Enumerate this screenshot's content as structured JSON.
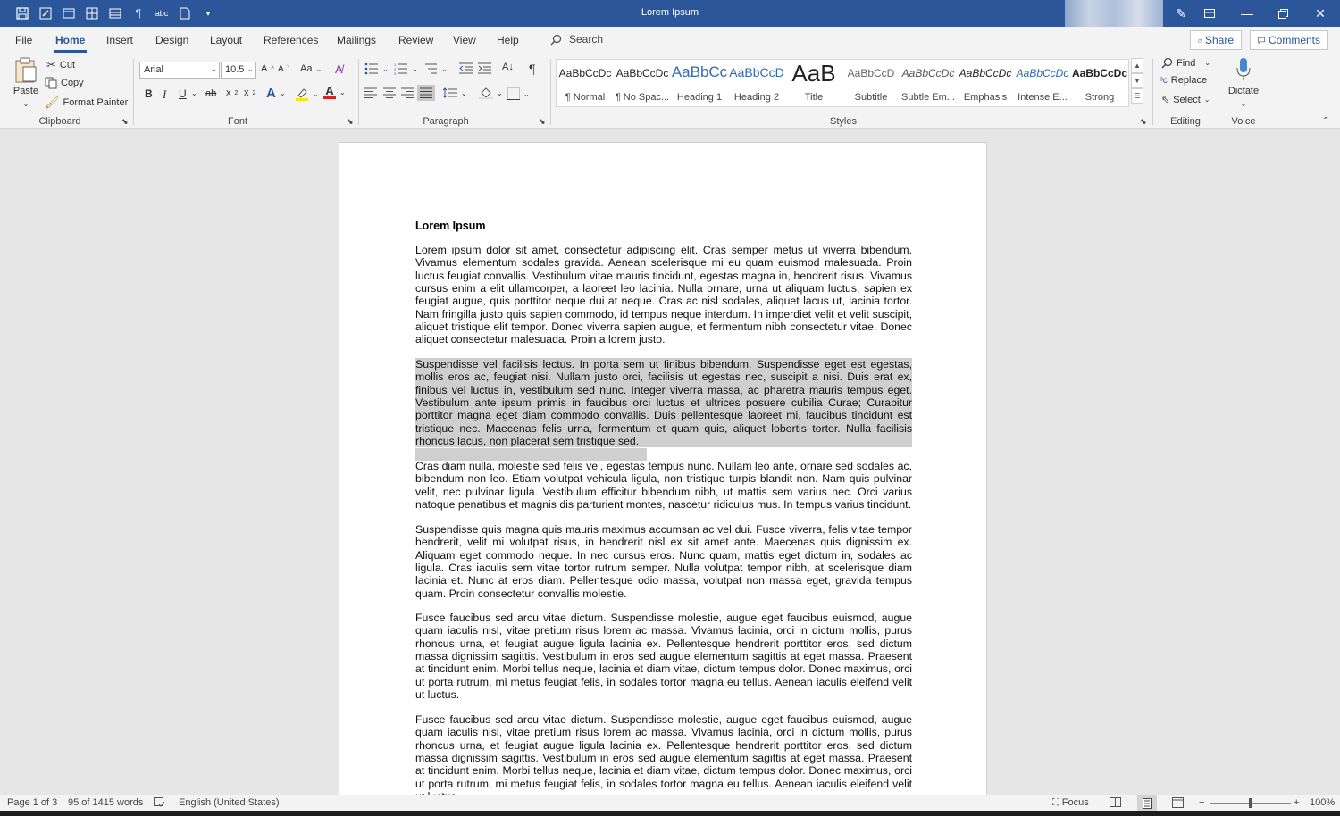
{
  "window": {
    "title": "Lorem Ipsum",
    "controls": [
      "minimize",
      "restore",
      "close"
    ]
  },
  "qat_icons": [
    "save-icon",
    "edit-icon",
    "window-icon",
    "table-icon",
    "layout-icon",
    "pilcrow-icon",
    "spelling-icon",
    "new-doc-icon",
    "customize-icon"
  ],
  "tabs": [
    "File",
    "Home",
    "Insert",
    "Design",
    "Layout",
    "References",
    "Mailings",
    "Review",
    "View",
    "Help"
  ],
  "active_tab": "Home",
  "search": {
    "label": "Search"
  },
  "top_right": {
    "share": "Share",
    "comments": "Comments"
  },
  "clipboard": {
    "paste": "Paste",
    "cut": "Cut",
    "copy": "Copy",
    "format_painter": "Format Painter",
    "label": "Clipboard"
  },
  "font": {
    "name": "Arial",
    "size": "10.5",
    "change_case": "Aa",
    "bold": "B",
    "italic": "I",
    "underline": "U",
    "strike": "ab",
    "subscript": "x",
    "superscript": "x",
    "label": "Font"
  },
  "paragraph": {
    "label": "Paragraph"
  },
  "styles": {
    "label": "Styles",
    "items": [
      {
        "preview": "AaBbCcDc",
        "name": "¶ Normal"
      },
      {
        "preview": "AaBbCcDc",
        "name": "¶ No Spac..."
      },
      {
        "preview": "AaBbCc",
        "name": "Heading 1"
      },
      {
        "preview": "AaBbCcD",
        "name": "Heading 2"
      },
      {
        "preview": "AaB",
        "name": "Title"
      },
      {
        "preview": "AaBbCcD",
        "name": "Subtitle"
      },
      {
        "preview": "AaBbCcDc",
        "name": "Subtle Em..."
      },
      {
        "preview": "AaBbCcDc",
        "name": "Emphasis"
      },
      {
        "preview": "AaBbCcDc",
        "name": "Intense E..."
      },
      {
        "preview": "AaBbCcDc",
        "name": "Strong"
      }
    ]
  },
  "editing": {
    "find": "Find",
    "replace": "Replace",
    "select": "Select",
    "label": "Editing"
  },
  "voice": {
    "dictate": "Dictate",
    "label": "Voice"
  },
  "document": {
    "heading": "Lorem Ipsum",
    "paragraphs": [
      "Lorem ipsum dolor sit amet, consectetur adipiscing elit. Cras semper metus ut viverra bibendum. Vivamus elementum sodales gravida. Aenean scelerisque mi eu quam euismod malesuada. Proin luctus feugiat convallis. Vestibulum vitae mauris tincidunt, egestas magna in, hendrerit risus. Vivamus cursus enim a elit ullamcorper, a laoreet leo lacinia. Nulla ornare, urna ut aliquam luctus, sapien ex feugiat augue, quis porttitor neque dui at neque. Cras ac nisl sodales, aliquet lacus ut, lacinia tortor. Nam fringilla justo quis sapien commodo, id tempus neque interdum. In imperdiet velit et velit suscipit, aliquet tristique elit tempor. Donec viverra sapien augue, et fermentum nibh consectetur vitae. Donec aliquet consectetur malesuada. Proin a lorem justo.",
      "Suspendisse vel facilisis lectus. In porta sem ut finibus bibendum. Suspendisse eget est egestas, mollis eros ac, feugiat nisi. Nullam justo orci, facilisis ut egestas nec, suscipit a nisi. Duis erat ex, finibus vel luctus in, vestibulum sed nunc. Integer viverra massa, ac pharetra mauris tempus eget. Vestibulum ante ipsum primis in faucibus orci luctus et ultrices posuere cubilia Curae; Curabitur porttitor magna eget diam commodo convallis. Duis pellentesque laoreet mi, faucibus tincidunt est tristique nec. Maecenas felis urna, fermentum et quam quis, aliquet lobortis tortor. Nulla facilisis rhoncus lacus, non placerat sem tristique sed.",
      "Cras diam nulla, molestie sed felis vel, egestas tempus nunc. Nullam leo ante, ornare sed sodales ac, bibendum non leo. Etiam volutpat vehicula ligula, non tristique turpis blandit non. Nam quis pulvinar velit, nec pulvinar ligula. Vestibulum efficitur bibendum nibh, ut mattis sem varius nec. Orci varius natoque penatibus et magnis dis parturient montes, nascetur ridiculus mus. In tempus varius tincidunt.",
      "Suspendisse quis magna quis mauris maximus accumsan ac vel dui. Fusce viverra, felis vitae tempor hendrerit, velit mi volutpat risus, in hendrerit nisl ex sit amet ante. Maecenas quis dignissim ex. Aliquam eget commodo neque. In nec cursus eros. Nunc quam, mattis eget dictum in, sodales ac ligula. Cras iaculis sem vitae tortor rutrum semper. Nulla volutpat tempor nibh, at scelerisque diam lacinia et. Nunc at eros diam. Pellentesque odio massa, volutpat non massa eget, gravida tempus quam. Proin consectetur convallis molestie.",
      "Fusce faucibus sed arcu vitae dictum. Suspendisse molestie, augue eget faucibus euismod, augue quam iaculis nisl, vitae pretium risus lorem ac massa. Vivamus lacinia, orci in dictum mollis, purus rhoncus urna, et feugiat augue ligula lacinia ex. Pellentesque hendrerit porttitor eros, sed dictum massa dignissim sagittis. Vestibulum in eros sed augue elementum sagittis at eget massa. Praesent at tincidunt enim. Morbi tellus neque, lacinia et diam vitae, dictum tempus dolor. Donec maximus, orci ut porta rutrum, mi metus feugiat felis, in sodales tortor magna eu tellus. Aenean iaculis eleifend velit ut luctus.",
      "Fusce faucibus sed arcu vitae dictum. Suspendisse molestie, augue eget faucibus euismod, augue quam iaculis nisl, vitae pretium risus lorem ac massa. Vivamus lacinia, orci in dictum mollis, purus rhoncus urna, et feugiat augue ligula lacinia ex. Pellentesque hendrerit porttitor eros, sed dictum massa dignissim sagittis. Vestibulum in eros sed augue elementum sagittis at eget massa. Praesent at tincidunt enim. Morbi tellus neque, lacinia et diam vitae, dictum tempus dolor. Donec maximus, orci ut porta rutrum, mi metus feugiat felis, in sodales tortor magna eu tellus. Aenean iaculis eleifend velit ut luctus."
    ]
  },
  "status": {
    "page": "Page 1 of 3",
    "words": "95 of 1415 words",
    "language": "English (United States)",
    "focus": "Focus",
    "zoom": "100%",
    "zoom_minus": "−",
    "zoom_plus": "+"
  },
  "colors": {
    "accent": "#2b579a",
    "selection": "#cfcfcf",
    "ribbon_bg": "#f3f3f3"
  }
}
